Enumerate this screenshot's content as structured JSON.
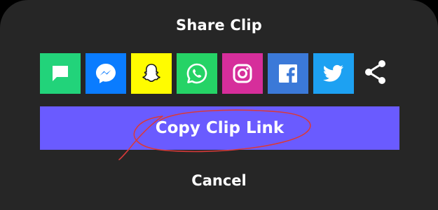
{
  "sheet": {
    "title": "Share Clip",
    "copy_button_label": "Copy Clip Link",
    "cancel_label": "Cancel"
  },
  "share_targets": [
    {
      "name": "sms",
      "icon": "message-bubble-icon",
      "bg": "#22d37a"
    },
    {
      "name": "messenger",
      "icon": "messenger-icon",
      "bg": "#0a7cff"
    },
    {
      "name": "snapchat",
      "icon": "snapchat-ghost-icon",
      "bg": "#fffc00"
    },
    {
      "name": "whatsapp",
      "icon": "whatsapp-icon",
      "bg": "#25d366"
    },
    {
      "name": "instagram",
      "icon": "instagram-icon",
      "bg": "#d62e9b"
    },
    {
      "name": "facebook",
      "icon": "facebook-icon",
      "bg": "#3b79d8"
    },
    {
      "name": "twitter",
      "icon": "twitter-bird-icon",
      "bg": "#1da1f2"
    }
  ],
  "more_icon": "share-more-icon",
  "colors": {
    "sheet_bg": "#262626",
    "accent": "#6a5bff",
    "annotation": "#d93a3a"
  }
}
